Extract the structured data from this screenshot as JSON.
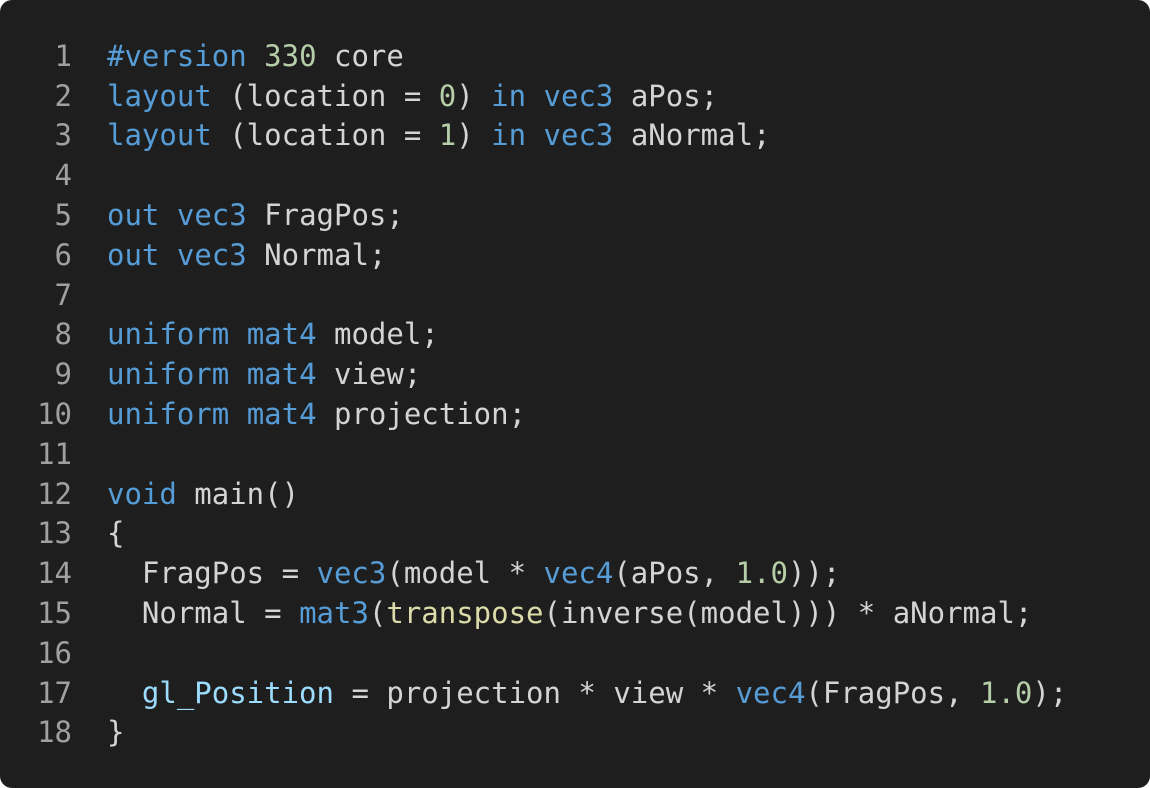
{
  "editor": {
    "language": "GLSL",
    "colors": {
      "background": "#1e1e1e",
      "text": "#d4d4d4",
      "line_number": "#a0a0a0",
      "keyword": "#569cd6",
      "number": "#b5cea8",
      "function": "#dcdcaa",
      "builtin_variable": "#9cdcfe"
    },
    "lines": [
      {
        "number": "1",
        "tokens": [
          {
            "t": "#version",
            "c": "kw"
          },
          {
            "t": " ",
            "c": "txt"
          },
          {
            "t": "330",
            "c": "num"
          },
          {
            "t": " core",
            "c": "txt"
          }
        ]
      },
      {
        "number": "2",
        "tokens": [
          {
            "t": "layout",
            "c": "kw"
          },
          {
            "t": " (location = ",
            "c": "txt"
          },
          {
            "t": "0",
            "c": "num"
          },
          {
            "t": ") ",
            "c": "txt"
          },
          {
            "t": "in",
            "c": "kw"
          },
          {
            "t": " ",
            "c": "txt"
          },
          {
            "t": "vec3",
            "c": "kw"
          },
          {
            "t": " aPos;",
            "c": "txt"
          }
        ]
      },
      {
        "number": "3",
        "tokens": [
          {
            "t": "layout",
            "c": "kw"
          },
          {
            "t": " (location = ",
            "c": "txt"
          },
          {
            "t": "1",
            "c": "num"
          },
          {
            "t": ") ",
            "c": "txt"
          },
          {
            "t": "in",
            "c": "kw"
          },
          {
            "t": " ",
            "c": "txt"
          },
          {
            "t": "vec3",
            "c": "kw"
          },
          {
            "t": " aNormal;",
            "c": "txt"
          }
        ]
      },
      {
        "number": "4",
        "tokens": []
      },
      {
        "number": "5",
        "tokens": [
          {
            "t": "out",
            "c": "kw"
          },
          {
            "t": " ",
            "c": "txt"
          },
          {
            "t": "vec3",
            "c": "kw"
          },
          {
            "t": " FragPos;",
            "c": "txt"
          }
        ]
      },
      {
        "number": "6",
        "tokens": [
          {
            "t": "out",
            "c": "kw"
          },
          {
            "t": " ",
            "c": "txt"
          },
          {
            "t": "vec3",
            "c": "kw"
          },
          {
            "t": " Normal;",
            "c": "txt"
          }
        ]
      },
      {
        "number": "7",
        "tokens": []
      },
      {
        "number": "8",
        "tokens": [
          {
            "t": "uniform",
            "c": "kw"
          },
          {
            "t": " ",
            "c": "txt"
          },
          {
            "t": "mat4",
            "c": "kw"
          },
          {
            "t": " model;",
            "c": "txt"
          }
        ]
      },
      {
        "number": "9",
        "tokens": [
          {
            "t": "uniform",
            "c": "kw"
          },
          {
            "t": " ",
            "c": "txt"
          },
          {
            "t": "mat4",
            "c": "kw"
          },
          {
            "t": " view;",
            "c": "txt"
          }
        ]
      },
      {
        "number": "10",
        "tokens": [
          {
            "t": "uniform",
            "c": "kw"
          },
          {
            "t": " ",
            "c": "txt"
          },
          {
            "t": "mat4",
            "c": "kw"
          },
          {
            "t": " projection;",
            "c": "txt"
          }
        ]
      },
      {
        "number": "11",
        "tokens": []
      },
      {
        "number": "12",
        "tokens": [
          {
            "t": "void",
            "c": "kw"
          },
          {
            "t": " main()",
            "c": "txt"
          }
        ]
      },
      {
        "number": "13",
        "tokens": [
          {
            "t": "{",
            "c": "txt"
          }
        ]
      },
      {
        "number": "14",
        "tokens": [
          {
            "t": "  FragPos = ",
            "c": "txt"
          },
          {
            "t": "vec3",
            "c": "kw"
          },
          {
            "t": "(model * ",
            "c": "txt"
          },
          {
            "t": "vec4",
            "c": "kw"
          },
          {
            "t": "(aPos, ",
            "c": "txt"
          },
          {
            "t": "1.0",
            "c": "num"
          },
          {
            "t": "));",
            "c": "txt"
          }
        ]
      },
      {
        "number": "15",
        "tokens": [
          {
            "t": "  Normal = ",
            "c": "txt"
          },
          {
            "t": "mat3",
            "c": "kw"
          },
          {
            "t": "(",
            "c": "txt"
          },
          {
            "t": "transpose",
            "c": "fn"
          },
          {
            "t": "(inverse(model))) * aNormal;",
            "c": "txt"
          }
        ]
      },
      {
        "number": "16",
        "tokens": []
      },
      {
        "number": "17",
        "tokens": [
          {
            "t": "  ",
            "c": "txt"
          },
          {
            "t": "gl_Position",
            "c": "var"
          },
          {
            "t": " = projection * view * ",
            "c": "txt"
          },
          {
            "t": "vec4",
            "c": "kw"
          },
          {
            "t": "(FragPos, ",
            "c": "txt"
          },
          {
            "t": "1.0",
            "c": "num"
          },
          {
            "t": ");",
            "c": "txt"
          }
        ]
      },
      {
        "number": "18",
        "tokens": [
          {
            "t": "}",
            "c": "txt"
          }
        ]
      }
    ]
  }
}
